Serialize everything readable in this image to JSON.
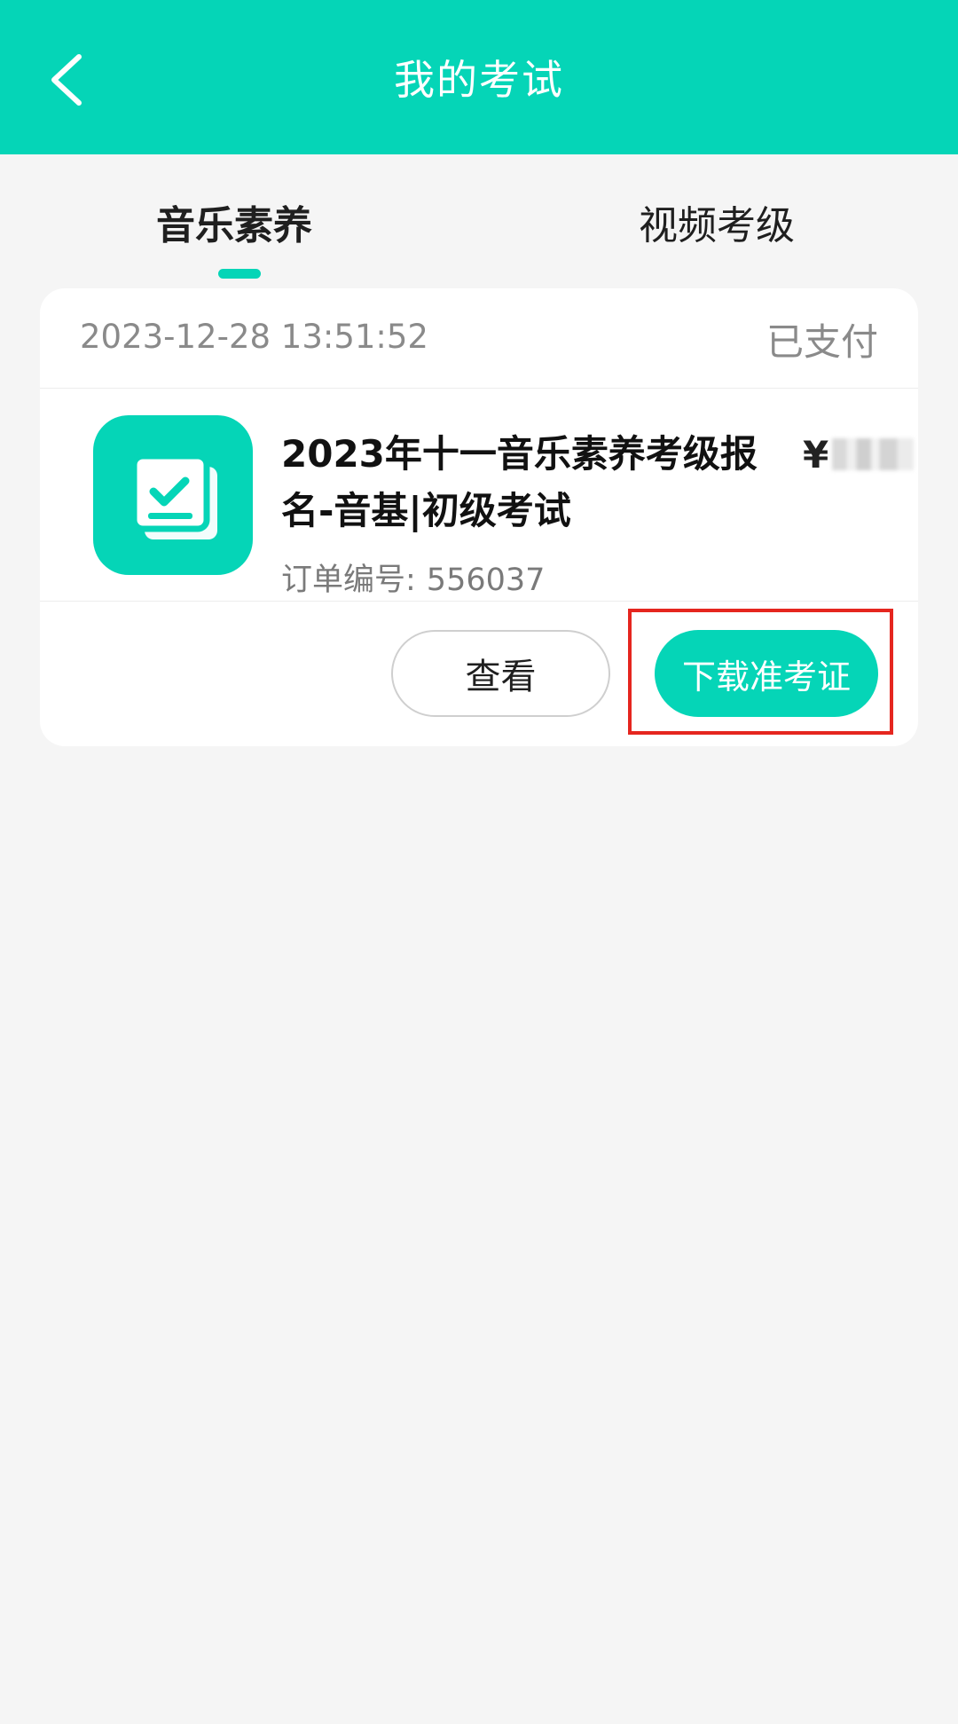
{
  "header": {
    "title": "我的考试"
  },
  "tabs": [
    {
      "label": "音乐素养",
      "active": true
    },
    {
      "label": "视频考级",
      "active": false
    }
  ],
  "order": {
    "time": "2023-12-28 13:51:52",
    "status": "已支付",
    "title": "2023年十一音乐素养考级报名-音基|初级考试",
    "price_symbol": "¥",
    "order_no_label": "订单编号:",
    "order_no": "556037",
    "icon": "checklist-icon"
  },
  "actions": {
    "view_label": "查看",
    "download_label": "下载准考证"
  },
  "colors": {
    "accent": "#05d5b7",
    "highlight": "#e5261f",
    "background": "#f5f5f5"
  }
}
